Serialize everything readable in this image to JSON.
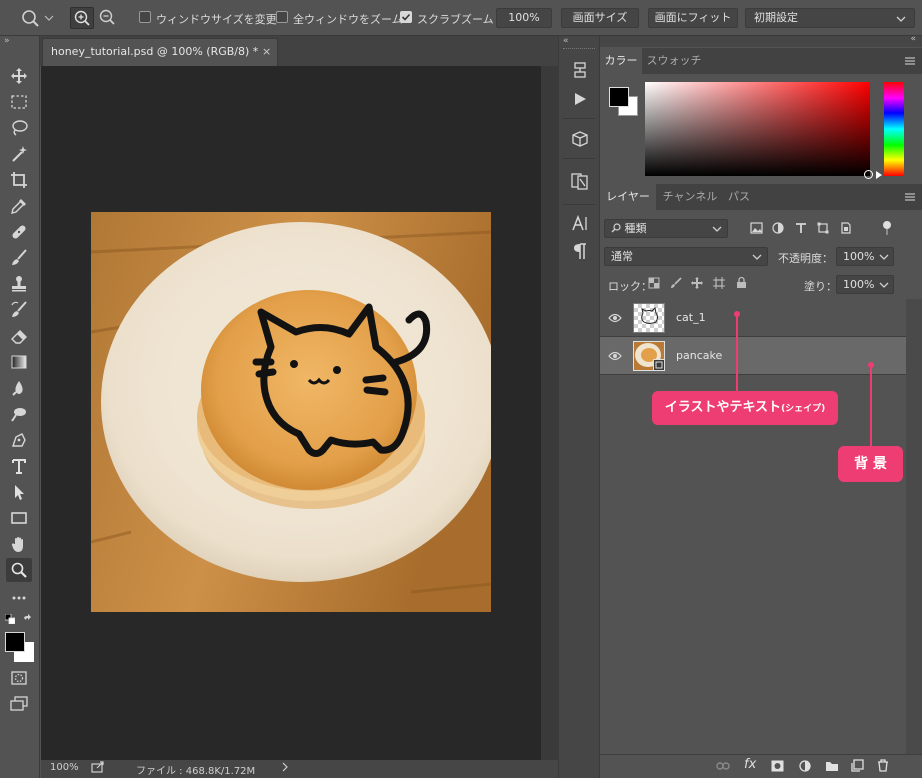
{
  "options_bar": {
    "checkbox_resize_window": "ウィンドウサイズを変更",
    "checkbox_zoom_all": "全ウィンドウをズーム",
    "checkbox_scrubby_zoom": "スクラブズーム",
    "zoom_value": "100%",
    "btn_screen_size": "画面サイズ",
    "btn_fit_screen": "画面にフィット",
    "preset_select": "初期設定"
  },
  "document": {
    "tab_title": "honey_tutorial.psd @ 100% (RGB/8) *",
    "status_zoom": "100%",
    "status_file": "ファイル : 468.8K/1.72M"
  },
  "color_panel": {
    "tab_color": "カラー",
    "tab_swatches": "スウォッチ",
    "foreground": "#000000",
    "background": "#ffffff"
  },
  "layers_panel": {
    "tab_layers": "レイヤー",
    "tab_channels": "チャンネル",
    "tab_paths": "パス",
    "filter_kind": "種類",
    "blend_mode": "通常",
    "opacity_label": "不透明度：",
    "opacity_value": "100%",
    "lock_label": "ロック：",
    "fill_label": "塗り：",
    "fill_value": "100%",
    "layers": [
      {
        "name": "cat_1",
        "visible": true,
        "selected": false
      },
      {
        "name": "pancake",
        "visible": true,
        "selected": true
      }
    ]
  },
  "annotations": {
    "illustration": "イラストやテキスト",
    "illustration_suffix": "(シェイプ)",
    "background": "背 景"
  },
  "accent_color": "#ee3d72"
}
